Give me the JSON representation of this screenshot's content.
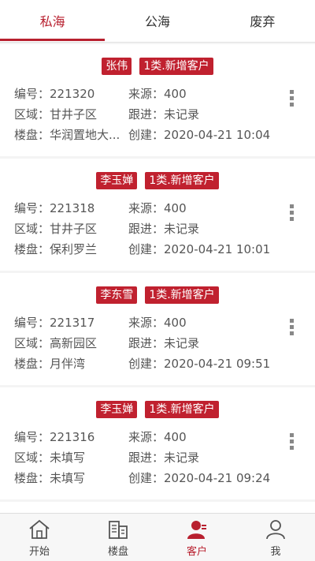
{
  "tabs": [
    {
      "label": "私海",
      "active": true
    },
    {
      "label": "公海",
      "active": false
    },
    {
      "label": "废弃",
      "active": false
    }
  ],
  "customers": [
    {
      "name": "张伟",
      "level": "1类.新增客户",
      "id_label": "编号：",
      "id": "221320",
      "source_label": "来源：",
      "source": "400",
      "area_label": "区域：",
      "area": "甘井子区",
      "follow_label": "跟进：",
      "follow": "未记录",
      "building_label": "楼盘：",
      "building": "华润置地大...",
      "created_label": "创建：",
      "created": "2020-04-21 10:04"
    },
    {
      "name": "李玉婵",
      "level": "1类.新增客户",
      "id_label": "编号：",
      "id": "221318",
      "source_label": "来源：",
      "source": "400",
      "area_label": "区域：",
      "area": "甘井子区",
      "follow_label": "跟进：",
      "follow": "未记录",
      "building_label": "楼盘：",
      "building": "保利罗兰",
      "created_label": "创建：",
      "created": "2020-04-21 10:01"
    },
    {
      "name": "李东雪",
      "level": "1类.新增客户",
      "id_label": "编号：",
      "id": "221317",
      "source_label": "来源：",
      "source": "400",
      "area_label": "区域：",
      "area": "高新园区",
      "follow_label": "跟进：",
      "follow": "未记录",
      "building_label": "楼盘：",
      "building": "月伴湾",
      "created_label": "创建：",
      "created": "2020-04-21 09:51"
    },
    {
      "name": "李玉婵",
      "level": "1类.新增客户",
      "id_label": "编号：",
      "id": "221316",
      "source_label": "来源：",
      "source": "400",
      "area_label": "区域：",
      "area": "未填写",
      "follow_label": "跟进：",
      "follow": "未记录",
      "building_label": "楼盘：",
      "building": "未填写",
      "created_label": "创建：",
      "created": "2020-04-21 09:24"
    }
  ],
  "bottom_nav": [
    {
      "label": "开始",
      "icon": "home-icon",
      "active": false
    },
    {
      "label": "楼盘",
      "icon": "building-icon",
      "active": false
    },
    {
      "label": "客户",
      "icon": "customer-icon",
      "active": true
    },
    {
      "label": "我",
      "icon": "user-icon",
      "active": false
    }
  ],
  "colors": {
    "accent": "#b8202f",
    "tag_bg": "#c0212f"
  }
}
